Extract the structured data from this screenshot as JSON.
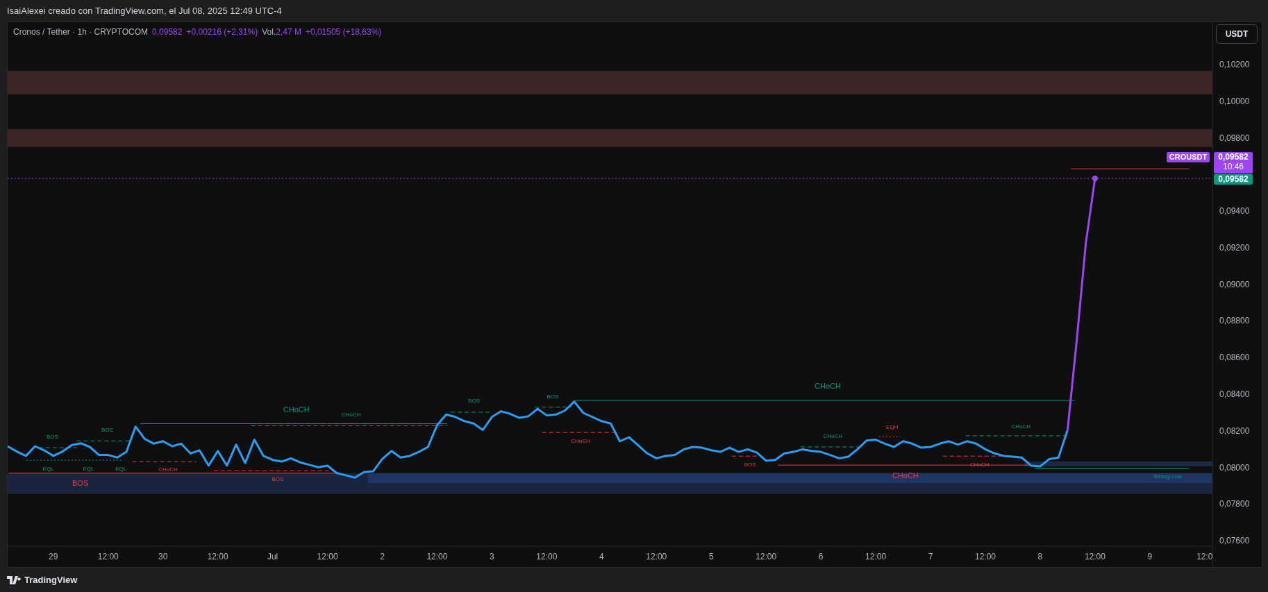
{
  "header": {
    "text": "IsaiAlexei creado con TradingView.com, el Jul 08, 2025 12:49 UTC-4"
  },
  "chart": {
    "legend": {
      "symbol": "Cronos / Tether · 1h · CRYPTOCOM",
      "price": "0,09582",
      "change": "+0,00216 (+2,31%)",
      "volume_label": "Vol.",
      "volume": "2,47 M",
      "volume_change": "+0,01505 (+18,63%)"
    },
    "currency_button": "USDT",
    "symbol_label": "CROUSDT",
    "price_badge": {
      "price": "0,09582",
      "countdown": "10:46"
    },
    "line_price_badge": "0,09582",
    "chart_data": {
      "type": "line",
      "categories": [
        null,
        null,
        null,
        null,
        null,
        "29",
        null,
        null,
        null,
        null,
        null,
        "12:00",
        null,
        null,
        null,
        null,
        null,
        "30",
        null,
        null,
        null,
        null,
        null,
        "12:00",
        null,
        null,
        null,
        null,
        null,
        "Jul",
        null,
        null,
        null,
        null,
        null,
        "12:00",
        null,
        null,
        null,
        null,
        null,
        "2",
        null,
        null,
        null,
        null,
        null,
        "12:00",
        null,
        null,
        null,
        null,
        null,
        "3",
        null,
        null,
        null,
        null,
        null,
        "12:00",
        null,
        null,
        null,
        null,
        null,
        "4",
        null,
        null,
        null,
        null,
        null,
        "12:00",
        null,
        null,
        null,
        null,
        null,
        "5",
        null,
        null,
        null,
        null,
        null,
        "12:00",
        null,
        null,
        null,
        null,
        null,
        "6",
        null,
        null,
        null,
        null,
        null,
        "12:00",
        null,
        null,
        null,
        null,
        null,
        "7",
        null,
        null,
        null,
        null,
        null,
        "12:00",
        null,
        null,
        null,
        null,
        null,
        "8",
        null,
        null,
        null,
        null,
        null,
        "12:00",
        null,
        null,
        null,
        null,
        null,
        "9",
        null,
        null,
        null,
        null,
        null,
        "12:0"
      ],
      "series": [
        {
          "color": "#2a9df4",
          "values": [
            0.08119,
            0.0809,
            0.08066,
            0.08119,
            0.08097,
            0.08066,
            0.0809,
            0.08125,
            0.08135,
            0.08115,
            0.08071,
            0.08071,
            0.08057,
            0.08088,
            0.08226,
            0.08159,
            0.08133,
            0.08146,
            0.08119,
            0.08133,
            0.0808,
            0.08097,
            0.08013,
            0.08093,
            0.08013,
            0.08128,
            0.08027,
            0.08155,
            0.08066,
            0.08044,
            0.08035,
            0.08053,
            0.08031,
            0.08018,
            0.08004,
            0.08013,
            0.07973,
            0.0796,
            0.07947,
            0.07978,
            0.07982,
            0.08049,
            0.08093,
            0.08057,
            0.08066,
            0.08088,
            0.08115,
            0.08234,
            0.08292,
            0.08279,
            0.08256,
            0.08243,
            0.08208,
            0.08279,
            0.0831,
            0.08296,
            0.08274,
            0.08283,
            0.08323,
            0.08287,
            0.08292,
            0.08314,
            0.08363,
            0.08301,
            0.08279,
            0.08256,
            0.08243,
            0.08146,
            0.08168,
            0.08124,
            0.0808,
            0.08053,
            0.08066,
            0.08071,
            0.08102,
            0.08115,
            0.08111,
            0.08097,
            0.08088,
            0.08111,
            0.08088,
            0.08102,
            0.08084,
            0.0804,
            0.08044,
            0.0808,
            0.08088,
            0.08102,
            0.08093,
            0.08088,
            0.08071,
            0.08053,
            0.08062,
            0.08102,
            0.0815,
            0.08155,
            0.08133,
            0.08115,
            0.08146,
            0.08133,
            0.08111,
            0.08115,
            0.08133,
            0.08146,
            0.08128,
            0.08146,
            0.08133,
            0.08102,
            0.0808,
            0.08066,
            0.08062,
            0.08057,
            0.08013,
            0.08009,
            0.08049,
            0.08057,
            0.08208,
            null,
            null,
            null,
            null,
            null,
            null,
            null,
            null,
            null,
            null,
            null,
            null,
            null,
            null,
            null
          ]
        },
        {
          "color": "#9b45f5",
          "values": [
            null,
            null,
            null,
            null,
            null,
            null,
            null,
            null,
            null,
            null,
            null,
            null,
            null,
            null,
            null,
            null,
            null,
            null,
            null,
            null,
            null,
            null,
            null,
            null,
            null,
            null,
            null,
            null,
            null,
            null,
            null,
            null,
            null,
            null,
            null,
            null,
            null,
            null,
            null,
            null,
            null,
            null,
            null,
            null,
            null,
            null,
            null,
            null,
            null,
            null,
            null,
            null,
            null,
            null,
            null,
            null,
            null,
            null,
            null,
            null,
            null,
            null,
            null,
            null,
            null,
            null,
            null,
            null,
            null,
            null,
            null,
            null,
            null,
            null,
            null,
            null,
            null,
            null,
            null,
            null,
            null,
            null,
            null,
            null,
            null,
            null,
            null,
            null,
            null,
            null,
            null,
            null,
            null,
            null,
            null,
            null,
            null,
            null,
            null,
            null,
            null,
            null,
            null,
            null,
            null,
            null,
            null,
            null,
            null,
            null,
            null,
            null,
            null,
            null,
            null,
            null,
            0.08208,
            0.08699,
            0.09229,
            0.09582,
            null,
            null,
            null,
            null,
            null,
            null,
            null,
            null,
            null,
            null,
            null,
            null
          ]
        }
      ],
      "ylim": [
        0.07573,
        0.10435
      ],
      "yticks": [
        {
          "value": 0.102,
          "label": "0,10200"
        },
        {
          "value": 0.1,
          "label": "0,10000"
        },
        {
          "value": 0.098,
          "label": "0,09800"
        },
        {
          "value": 0.094,
          "label": "0,09400"
        },
        {
          "value": 0.092,
          "label": "0,09200"
        },
        {
          "value": 0.09,
          "label": "0,09000"
        },
        {
          "value": 0.088,
          "label": "0,08800"
        },
        {
          "value": 0.086,
          "label": "0,08600"
        },
        {
          "value": 0.084,
          "label": "0,08400"
        },
        {
          "value": 0.082,
          "label": "0,08200"
        },
        {
          "value": 0.08,
          "label": "0,08000"
        },
        {
          "value": 0.078,
          "label": "0,07800"
        },
        {
          "value": 0.076,
          "label": "0,07600"
        }
      ],
      "annotations": [
        "BOS",
        "BOS",
        "EQL",
        "EQL",
        "EQL",
        "BOS",
        "CHoCH",
        "CHoCH",
        "CHoCH",
        "BOS",
        "BOS",
        "BOS",
        "CHoCH",
        "CHoCH",
        "BOS",
        "CHoCH",
        "EQH",
        "CHoCH",
        "CHoCH",
        "CHoCH",
        "Strong Low"
      ]
    }
  },
  "footer": {
    "brand": "TradingView"
  }
}
